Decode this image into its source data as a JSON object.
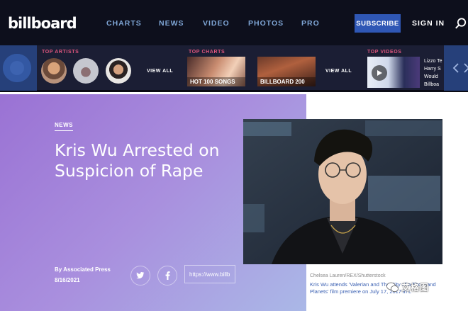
{
  "header": {
    "logo": "billboard",
    "nav": [
      "CHARTS",
      "NEWS",
      "VIDEO",
      "PHOTOS",
      "PRO"
    ],
    "subscribe_label": "SUBSCRIBE",
    "signin_label": "SIGN IN",
    "search_icon": "search-icon"
  },
  "strip": {
    "top_artists_label": "TOP ARTISTS",
    "top_charts_label": "TOP CHARTS",
    "top_videos_label": "TOP VIDEOS",
    "view_all_label": "VIEW ALL",
    "charts": [
      "HOT 100 SONGS",
      "BILLBOARD 200"
    ],
    "video_text_lines": [
      "Lizzo Te",
      "Harry S",
      "Would",
      "Billboa"
    ]
  },
  "article": {
    "kicker": "NEWS",
    "headline": "Kris Wu Arrested on Suspicion of Rape",
    "byline_prefix": "By",
    "author": "Associated Press",
    "date": "8/16/2021",
    "share_url": "https://www.billb",
    "photo_credit": "Chelsea Lauren/REX/Shutterstock",
    "caption": "Kris Wu attends 'Valerian and The City of a Thousand Planets' film premiere on July 17, 2017 in L",
    "watermark": "艾格图"
  },
  "colors": {
    "nav_bg": "#0d0f1c",
    "nav_link": "#7fa6d6",
    "subscribe_bg": "#2f57b5",
    "strip_bg": "#1b1e34",
    "section_label": "#e0567e",
    "hero_gradient_start": "#9a72d4",
    "hero_gradient_end": "#aab8e7",
    "caption_link": "#3d62b3"
  }
}
